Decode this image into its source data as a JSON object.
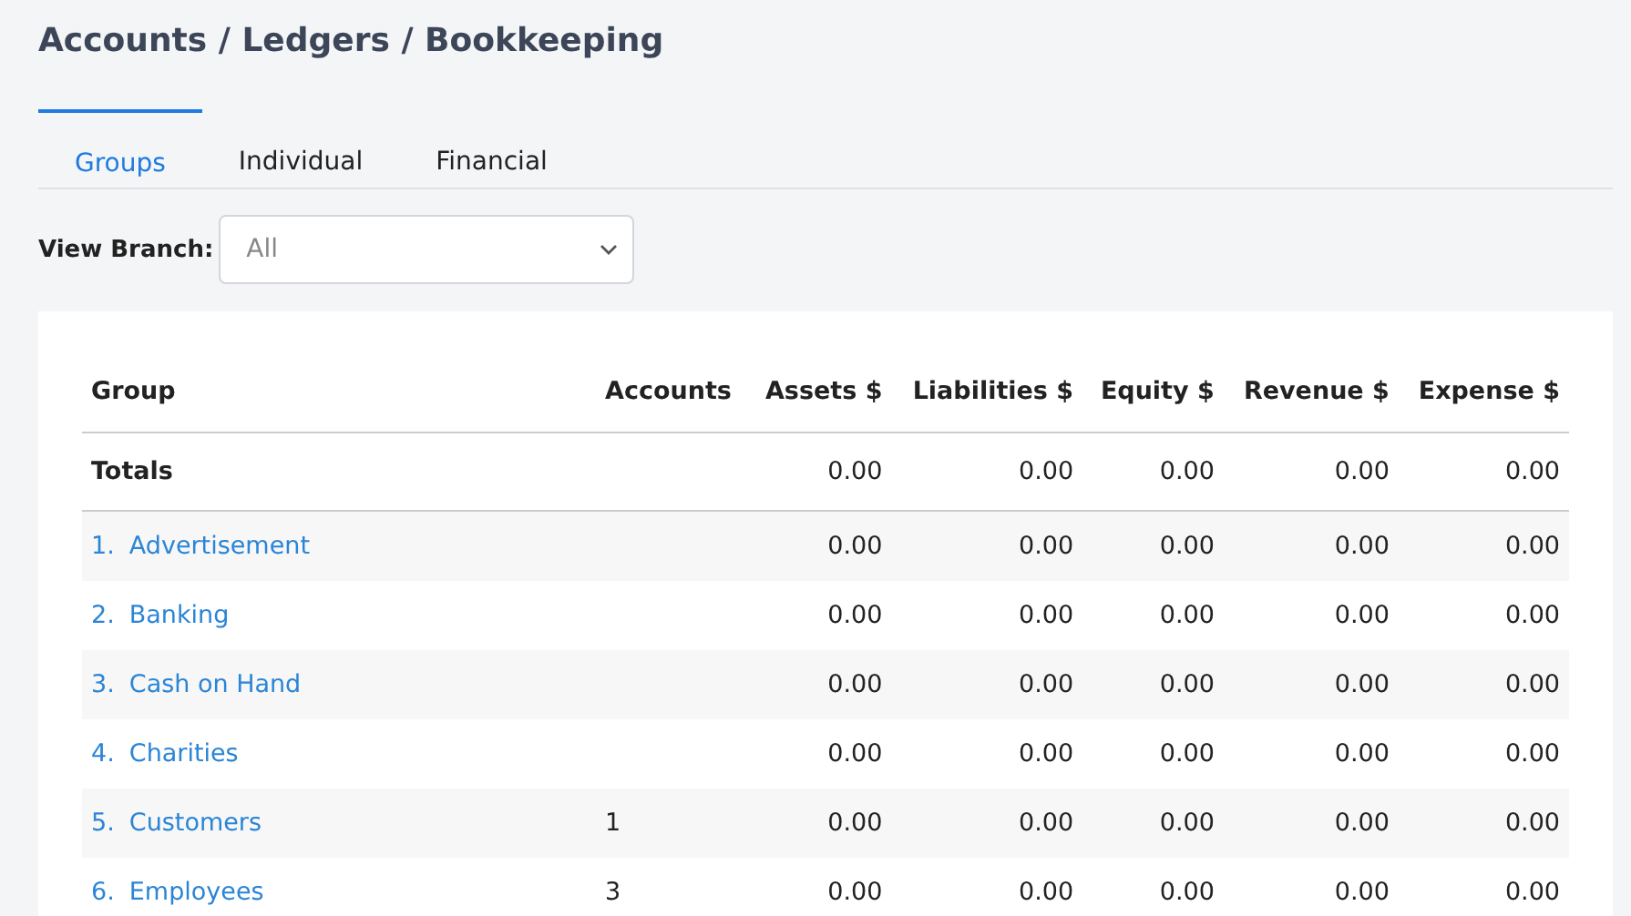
{
  "breadcrumb": "Accounts / Ledgers / Bookkeeping",
  "tabs": [
    {
      "label": "Groups",
      "selected": true
    },
    {
      "label": "Individual",
      "selected": false
    },
    {
      "label": "Financial",
      "selected": false
    }
  ],
  "filter": {
    "label": "View Branch:",
    "value": "All"
  },
  "table": {
    "columns": [
      "Group",
      "Accounts",
      "Assets $",
      "Liabilities $",
      "Equity $",
      "Revenue $",
      "Expense $"
    ],
    "totals": {
      "label": "Totals",
      "values": [
        "0.00",
        "0.00",
        "0.00",
        "0.00",
        "0.00"
      ]
    },
    "rows": [
      {
        "number": "1.",
        "name": "Advertisement",
        "values": [
          "0.00",
          "0.00",
          "0.00",
          "0.00",
          "0.00"
        ]
      },
      {
        "number": "2.",
        "name": "Banking",
        "values": [
          "0.00",
          "0.00",
          "0.00",
          "0.00",
          "0.00"
        ]
      },
      {
        "number": "3.",
        "name": "Cash on Hand",
        "values": [
          "0.00",
          "0.00",
          "0.00",
          "0.00",
          "0.00"
        ]
      },
      {
        "number": "4.",
        "name": "Charities",
        "values": [
          "0.00",
          "0.00",
          "0.00",
          "0.00",
          "0.00"
        ]
      },
      {
        "number": "5.",
        "name": "Customers",
        "accounts": "1",
        "values": [
          "0.00",
          "0.00",
          "0.00",
          "0.00",
          "0.00"
        ]
      },
      {
        "number": "6.",
        "name": "Employees",
        "accounts": "3",
        "values": [
          "0.00",
          "0.00",
          "0.00",
          "0.00",
          "0.00"
        ]
      }
    ]
  }
}
